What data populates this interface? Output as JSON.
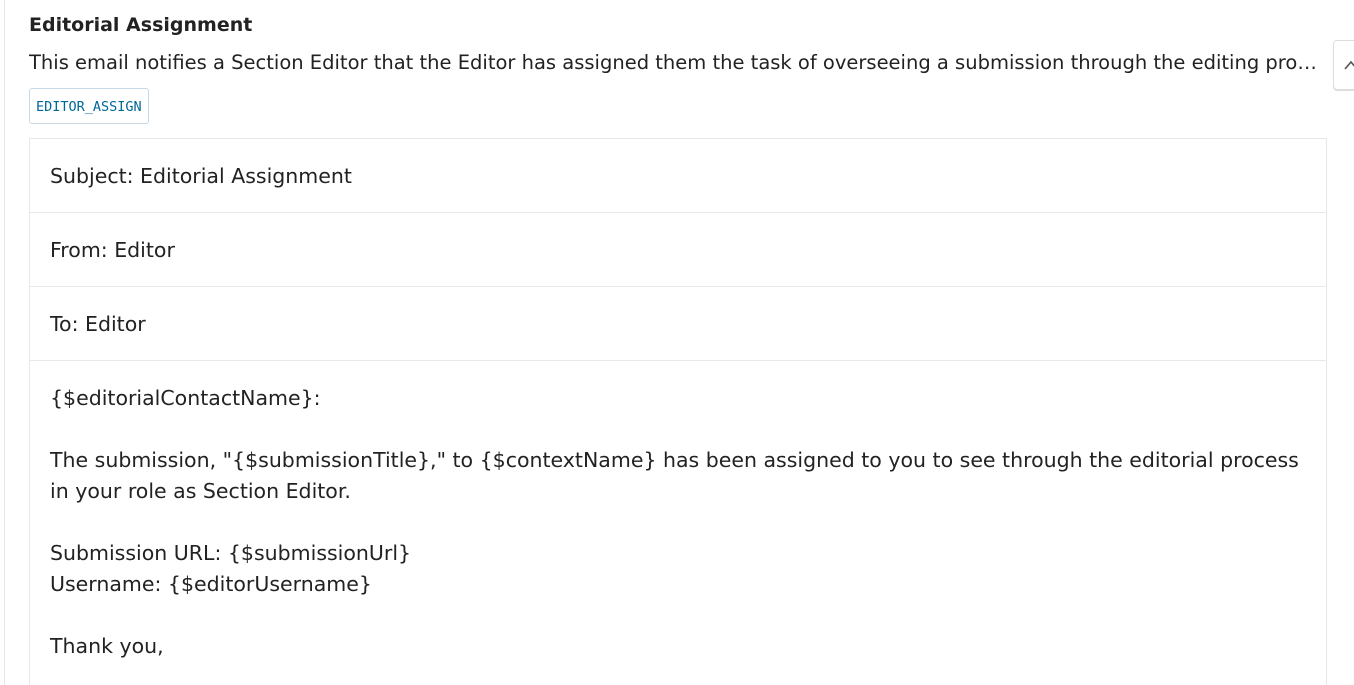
{
  "template": {
    "title": "Editorial Assignment",
    "description": "This email notifies a Section Editor that the Editor has assigned them the task of overseeing a submission through the editing process.",
    "key": "EDITOR_ASSIGN"
  },
  "preview": {
    "subject": "Subject: Editorial Assignment",
    "from": "From: Editor",
    "to": "To: Editor",
    "body": {
      "greeting": "{$editorialContactName}:",
      "paragraph1": "The submission, \"{$submissionTitle},\" to {$contextName} has been assigned to you to see through the editorial process in your role as Section Editor.",
      "submission_url": "Submission URL: {$submissionUrl}",
      "username": "Username: {$editorUsername}",
      "closing": "Thank you,"
    }
  },
  "icons": {
    "toggle": "chevron-up-icon"
  }
}
